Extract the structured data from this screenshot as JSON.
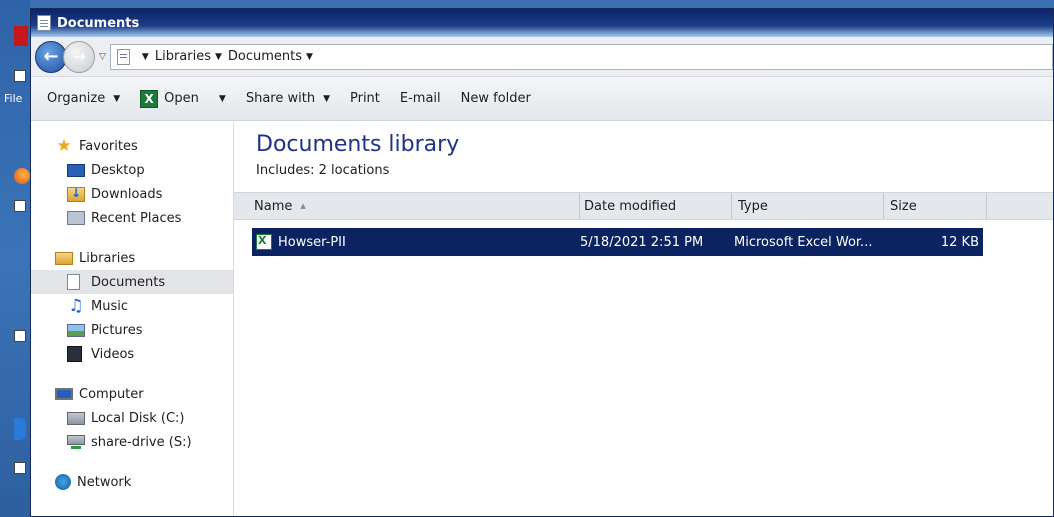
{
  "desktop": {
    "partial_label": "File"
  },
  "window": {
    "title": "Documents"
  },
  "address": {
    "breadcrumbs": [
      "Libraries",
      "Documents"
    ]
  },
  "toolbar": {
    "organize": "Organize",
    "open": "Open",
    "share_with": "Share with",
    "print": "Print",
    "email": "E-mail",
    "new_folder": "New folder"
  },
  "nav": {
    "favorites": {
      "label": "Favorites",
      "items": [
        "Desktop",
        "Downloads",
        "Recent Places"
      ]
    },
    "libraries": {
      "label": "Libraries",
      "items": [
        "Documents",
        "Music",
        "Pictures",
        "Videos"
      ],
      "selected": "Documents"
    },
    "computer": {
      "label": "Computer",
      "items": [
        "Local Disk (C:)",
        "share-drive (S:)"
      ]
    },
    "network": {
      "label": "Network"
    }
  },
  "content": {
    "title": "Documents library",
    "includes_label": "Includes:",
    "includes_value": "2 locations",
    "columns": [
      "Name",
      "Date modified",
      "Type",
      "Size"
    ],
    "rows": [
      {
        "name": "Howser-PII",
        "date_modified": "5/18/2021 2:51 PM",
        "type": "Microsoft Excel Wor...",
        "size": "12 KB",
        "selected": true
      }
    ]
  },
  "icons": {
    "back": "back-arrow-icon",
    "forward": "forward-arrow-icon",
    "excel": "excel-icon"
  },
  "colors": {
    "selection": "#0b2461",
    "title_bar": "#0a246a",
    "library_title": "#1e3287"
  }
}
